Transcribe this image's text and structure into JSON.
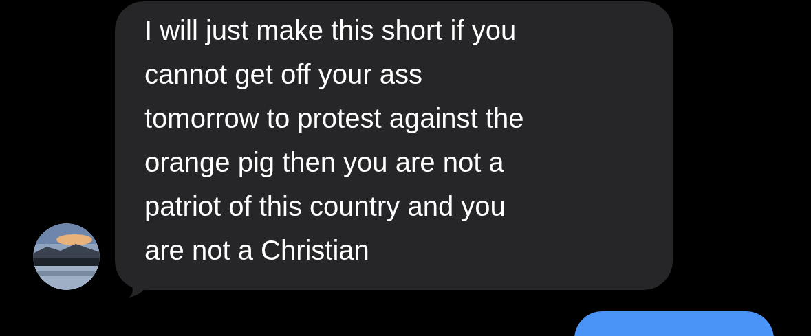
{
  "messages": [
    {
      "kind": "received",
      "lines": [
        "I will just make this short if you",
        "cannot get off your ass",
        "tomorrow to protest against the",
        "orange pig then you are not a",
        "patriot of this country and you",
        "are not a Christian"
      ]
    },
    {
      "kind": "sent"
    }
  ]
}
